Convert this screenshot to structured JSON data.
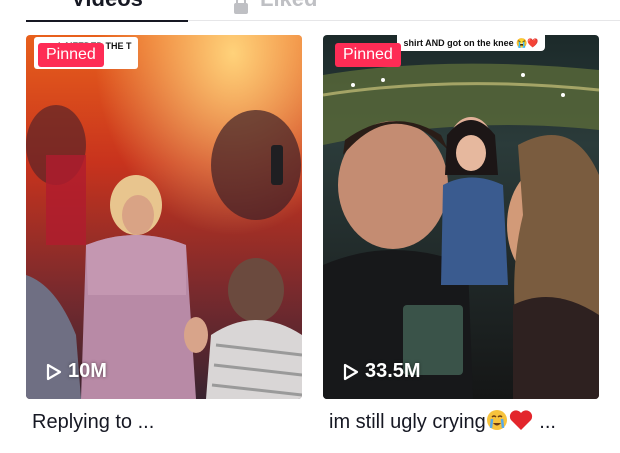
{
  "tabs": {
    "videos_label": "Videos",
    "liked_label": "Liked"
  },
  "videos": [
    {
      "pinned_label": "Pinned",
      "overlay_caption": "LAIFEDED THE T",
      "views": "10M",
      "description": "Replying to ..."
    },
    {
      "pinned_label": "Pinned",
      "overlay_caption": "shirt AND got on the knee 😭❤️",
      "views": "33.5M",
      "description": "im still ugly crying",
      "description_suffix": "..."
    }
  ],
  "colors": {
    "pinned": "#fe2c55",
    "text_primary": "#161823",
    "tab_inactive": "#bfc0c4"
  },
  "icons": [
    "lock-icon",
    "play-icon",
    "crying-emoji",
    "heart-emoji"
  ]
}
